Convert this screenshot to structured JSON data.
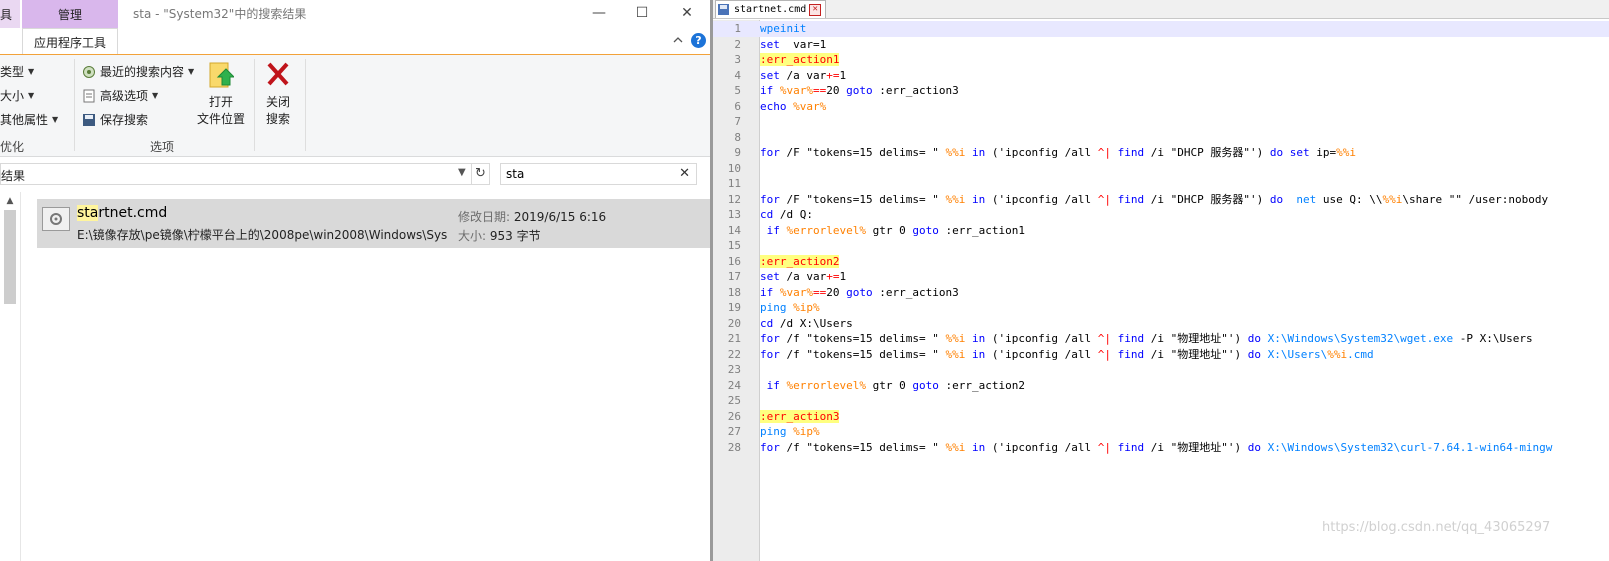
{
  "explorer": {
    "title_tabs": {
      "tools": "具",
      "manage": "管理"
    },
    "window_title": "sta - \"System32\"中的搜索结果",
    "window_buttons": {
      "minimize": "—",
      "maximize": "☐",
      "close": "✕"
    },
    "ribbon_tab": "应用程序工具",
    "ribbon": {
      "group1": {
        "type": "类型",
        "size": "大小",
        "other": "其他属性",
        "label": "优化"
      },
      "group2": {
        "recent": "最近的搜索内容",
        "advanced": "高级选项",
        "save": "保存搜索",
        "label": "选项"
      },
      "open_location": [
        "打开",
        "文件位置"
      ],
      "close_search": [
        "关闭",
        "搜索"
      ]
    },
    "address": "结果",
    "search_value": "sta",
    "result": {
      "name_highlight": "sta",
      "name_rest": "rtnet.cmd",
      "path": "E:\\镜像存放\\pe镜像\\柠檬平台上的\\2008pe\\win2008\\Windows\\Sys...",
      "modified_label": "修改日期:",
      "modified_value": "2019/6/15 6:16",
      "size_label": "大小:",
      "size_value": "953 字节"
    }
  },
  "editor": {
    "tab_name": "startnet.cmd",
    "lines": [
      [
        [
          "plain",
          "wpeinit",
          "tok-cmd"
        ]
      ],
      [
        [
          "set",
          "tok-kw"
        ],
        [
          "  var=1",
          "tok-plain"
        ]
      ],
      [
        [
          ":err_action1",
          "tok-label"
        ]
      ],
      [
        [
          "set",
          "tok-kw"
        ],
        [
          " /a var",
          "tok-plain"
        ],
        [
          "+=",
          "tok-op"
        ],
        [
          "1",
          "tok-plain"
        ]
      ],
      [
        [
          "if",
          "tok-kw"
        ],
        [
          " ",
          "tok-plain"
        ],
        [
          "%var%",
          "tok-var"
        ],
        [
          "==",
          "tok-op"
        ],
        [
          "20 ",
          "tok-plain"
        ],
        [
          "goto",
          "tok-kw"
        ],
        [
          " :err_action3",
          "tok-plain"
        ]
      ],
      [
        [
          "echo",
          "tok-kw"
        ],
        [
          " ",
          "tok-plain"
        ],
        [
          "%var%",
          "tok-var"
        ]
      ],
      [],
      [],
      [
        [
          "for",
          "tok-kw"
        ],
        [
          " /F \"tokens=15 delims= \" ",
          "tok-plain"
        ],
        [
          "%%i",
          "tok-var"
        ],
        [
          " ",
          "tok-plain"
        ],
        [
          "in",
          "tok-kw"
        ],
        [
          " ('ipconfig /all ",
          "tok-plain"
        ],
        [
          "^|",
          "tok-op"
        ],
        [
          " ",
          "tok-plain"
        ],
        [
          "find",
          "tok-kw"
        ],
        [
          " /i \"DHCP 服务器\"') ",
          "tok-plain"
        ],
        [
          "do",
          "tok-kw"
        ],
        [
          " ",
          "tok-plain"
        ],
        [
          "set",
          "tok-kw"
        ],
        [
          " ip=",
          "tok-plain"
        ],
        [
          "%%i",
          "tok-var"
        ]
      ],
      [],
      [],
      [
        [
          "for",
          "tok-kw"
        ],
        [
          " /F \"tokens=15 delims= \" ",
          "tok-plain"
        ],
        [
          "%%i",
          "tok-var"
        ],
        [
          " ",
          "tok-plain"
        ],
        [
          "in",
          "tok-kw"
        ],
        [
          " ('ipconfig /all ",
          "tok-plain"
        ],
        [
          "^|",
          "tok-op"
        ],
        [
          " ",
          "tok-plain"
        ],
        [
          "find",
          "tok-kw"
        ],
        [
          " /i \"DHCP 服务器\"') ",
          "tok-plain"
        ],
        [
          "do",
          "tok-kw"
        ],
        [
          "  ",
          "tok-plain"
        ],
        [
          "net",
          "tok-cmd"
        ],
        [
          " use Q: \\\\",
          "tok-plain"
        ],
        [
          "%%i",
          "tok-var"
        ],
        [
          "\\share \"\" /user:nobody",
          "tok-plain"
        ]
      ],
      [
        [
          "cd",
          "tok-kw"
        ],
        [
          " /d Q:",
          "tok-plain"
        ]
      ],
      [
        [
          " ",
          "tok-plain"
        ],
        [
          "if",
          "tok-kw"
        ],
        [
          " ",
          "tok-plain"
        ],
        [
          "%errorlevel%",
          "tok-var"
        ],
        [
          " gtr 0 ",
          "tok-plain"
        ],
        [
          "goto",
          "tok-kw"
        ],
        [
          " :err_action1",
          "tok-plain"
        ]
      ],
      [],
      [
        [
          ":err_action2",
          "tok-label"
        ]
      ],
      [
        [
          "set",
          "tok-kw"
        ],
        [
          " /a var",
          "tok-plain"
        ],
        [
          "+=",
          "tok-op"
        ],
        [
          "1",
          "tok-plain"
        ]
      ],
      [
        [
          "if",
          "tok-kw"
        ],
        [
          " ",
          "tok-plain"
        ],
        [
          "%var%",
          "tok-var"
        ],
        [
          "==",
          "tok-op"
        ],
        [
          "20 ",
          "tok-plain"
        ],
        [
          "goto",
          "tok-kw"
        ],
        [
          " :err_action3",
          "tok-plain"
        ]
      ],
      [
        [
          "ping",
          "tok-cmd"
        ],
        [
          " ",
          "tok-plain"
        ],
        [
          "%ip%",
          "tok-var"
        ]
      ],
      [
        [
          "cd",
          "tok-kw"
        ],
        [
          " /d X:\\Users",
          "tok-plain"
        ]
      ],
      [
        [
          "for",
          "tok-kw"
        ],
        [
          " /f \"tokens=15 delims= \" ",
          "tok-plain"
        ],
        [
          "%%i",
          "tok-var"
        ],
        [
          " ",
          "tok-plain"
        ],
        [
          "in",
          "tok-kw"
        ],
        [
          " ('ipconfig /all ",
          "tok-plain"
        ],
        [
          "^|",
          "tok-op"
        ],
        [
          " ",
          "tok-plain"
        ],
        [
          "find",
          "tok-kw"
        ],
        [
          " /i \"物理地址\"') ",
          "tok-plain"
        ],
        [
          "do",
          "tok-kw"
        ],
        [
          " ",
          "tok-plain"
        ],
        [
          "X:\\Windows\\System32\\wget.exe",
          "tok-cmd"
        ],
        [
          " -P X:\\Users",
          "tok-plain"
        ]
      ],
      [
        [
          "for",
          "tok-kw"
        ],
        [
          " /f \"tokens=15 delims= \" ",
          "tok-plain"
        ],
        [
          "%%i",
          "tok-var"
        ],
        [
          " ",
          "tok-plain"
        ],
        [
          "in",
          "tok-kw"
        ],
        [
          " ('ipconfig /all ",
          "tok-plain"
        ],
        [
          "^|",
          "tok-op"
        ],
        [
          " ",
          "tok-plain"
        ],
        [
          "find",
          "tok-kw"
        ],
        [
          " /i \"物理地址\"') ",
          "tok-plain"
        ],
        [
          "do",
          "tok-kw"
        ],
        [
          " ",
          "tok-plain"
        ],
        [
          "X:\\Users\\",
          "tok-cmd"
        ],
        [
          "%%i",
          "tok-var"
        ],
        [
          ".cmd",
          "tok-cmd"
        ]
      ],
      [],
      [
        [
          " ",
          "tok-plain"
        ],
        [
          "if",
          "tok-kw"
        ],
        [
          " ",
          "tok-plain"
        ],
        [
          "%errorlevel%",
          "tok-var"
        ],
        [
          " gtr 0 ",
          "tok-plain"
        ],
        [
          "goto",
          "tok-kw"
        ],
        [
          " :err_action2",
          "tok-plain"
        ]
      ],
      [],
      [
        [
          ":err_action3",
          "tok-label"
        ]
      ],
      [
        [
          "ping",
          "tok-cmd"
        ],
        [
          " ",
          "tok-plain"
        ],
        [
          "%ip%",
          "tok-var"
        ]
      ],
      [
        [
          "for",
          "tok-kw"
        ],
        [
          " /f \"tokens=15 delims= \" ",
          "tok-plain"
        ],
        [
          "%%i",
          "tok-var"
        ],
        [
          " ",
          "tok-plain"
        ],
        [
          "in",
          "tok-kw"
        ],
        [
          " ('ipconfig /all ",
          "tok-plain"
        ],
        [
          "^|",
          "tok-op"
        ],
        [
          " ",
          "tok-plain"
        ],
        [
          "find",
          "tok-kw"
        ],
        [
          " /i \"物理地址\"') ",
          "tok-plain"
        ],
        [
          "do",
          "tok-kw"
        ],
        [
          " ",
          "tok-plain"
        ],
        [
          "X:\\Windows\\System32\\curl-7.64.1-win64-mingw",
          "tok-cmd"
        ]
      ]
    ]
  },
  "watermark": "https://blog.csdn.net/qq_43065297",
  "colors": {
    "keyword": "#0000ff",
    "variable": "#ff8000",
    "operator": "#ff0000",
    "label_bg": "#ffff80",
    "command": "#0080ff",
    "ribbon_accent": "#f2a23a",
    "manage_tab": "#d9b7ec"
  },
  "icons": {
    "recent_searches": "recent-searches-icon",
    "advanced_options": "advanced-options-icon",
    "save_search": "save-search-icon",
    "open_location": "folder-arrow-icon",
    "close_search": "red-x-icon",
    "file": "cmd-file-icon",
    "help": "help-icon"
  }
}
